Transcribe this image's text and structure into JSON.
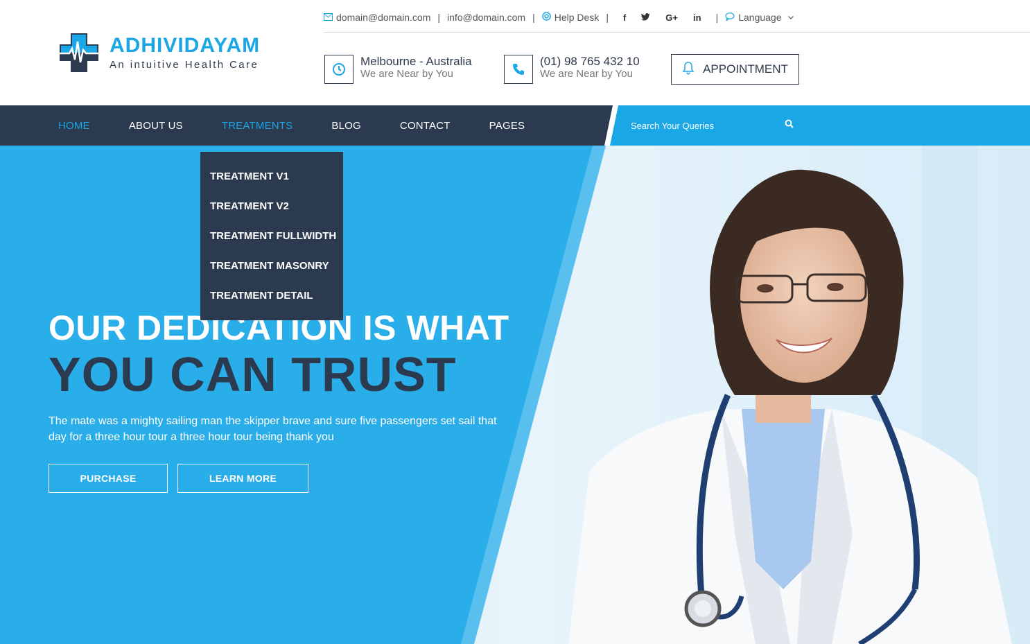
{
  "brand": {
    "name": "ADHIVIDAYAM",
    "tagline": "An intuitive Health Care"
  },
  "topbar": {
    "email1": "domain@domain.com",
    "email2": "info@domain.com",
    "helpdesk": "Help Desk",
    "social": [
      "f",
      "t",
      "G+",
      "in"
    ],
    "language": "Language"
  },
  "contacts": [
    {
      "title": "Melbourne - Australia",
      "subtitle": "We are Near by You",
      "icon": "clock-icon"
    },
    {
      "title": "(01) 98 765 432 10",
      "subtitle": "We are Near by You",
      "icon": "phone-icon"
    }
  ],
  "appointment_label": "APPOINTMENT",
  "nav": {
    "items": [
      "HOME",
      "ABOUT US",
      "TREATMENTS",
      "BLOG",
      "CONTACT",
      "PAGES"
    ],
    "active": "HOME",
    "open": "TREATMENTS",
    "search_placeholder": "Search Your Queries"
  },
  "dropdown": {
    "items": [
      "TREATMENT V1",
      "TREATMENT V2",
      "TREATMENT FULLWIDTH",
      "TREATMENT MASONRY",
      "TREATMENT DETAIL"
    ]
  },
  "hero": {
    "line1": "OUR DEDICATION IS WHAT",
    "line2": "YOU CAN TRUST",
    "text": "The mate was a mighty sailing man the skipper brave and sure five passengers set sail that day for a three hour tour a three hour tour being thank you",
    "primary_button": "PURCHASE",
    "secondary_button": "LEARN MORE"
  },
  "colors": {
    "accent": "#1ba6e6",
    "dark": "#2b3a4e",
    "hero_blue": "#29aeea"
  }
}
